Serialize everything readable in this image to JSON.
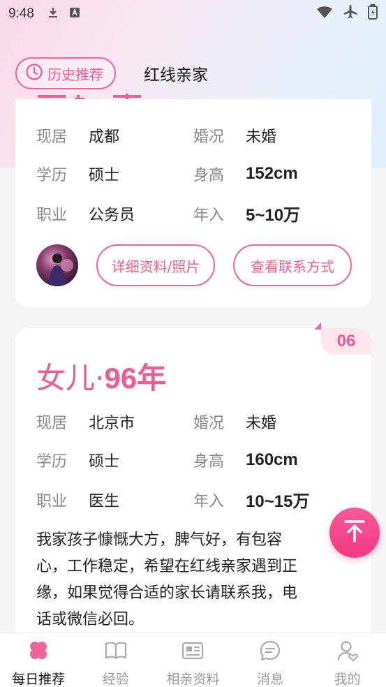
{
  "status_bar": {
    "time": "9:48"
  },
  "top_tabs": {
    "history": "历史推荐",
    "current": "红线亲家"
  },
  "card1": {
    "rows": [
      {
        "k1": "现居",
        "v1": "成都",
        "k2": "婚况",
        "v2": "未婚"
      },
      {
        "k1": "学历",
        "v1": "硕士",
        "k2": "身高",
        "v2": "152cm"
      },
      {
        "k1": "职业",
        "v1": "公务员",
        "k2": "年入",
        "v2": "5~10万"
      }
    ],
    "detail_btn": "详细资料/照片",
    "contact_btn": "查看联系方式"
  },
  "card2": {
    "badge": "06",
    "title_prefix": "女儿·",
    "title_year": "96年",
    "rows": [
      {
        "k1": "现居",
        "v1": "北京市",
        "k2": "婚况",
        "v2": "未婚"
      },
      {
        "k1": "学历",
        "v1": "硕士",
        "k2": "身高",
        "v2": "160cm"
      },
      {
        "k1": "职业",
        "v1": "医生",
        "k2": "年入",
        "v2": "10~15万"
      }
    ],
    "desc_lines": [
      "我家孩子慷慨大方，脾气好，有包容",
      "心，工作稳定，希望在红线亲家遇到正",
      "缘，如果觉得合适的家长请联系我，电",
      "话或微信必回。"
    ]
  },
  "nav": {
    "items": [
      {
        "label": "每日推荐"
      },
      {
        "label": "经验"
      },
      {
        "label": "相亲资料"
      },
      {
        "label": "消息"
      },
      {
        "label": "我的"
      }
    ]
  },
  "colors": {
    "accent": "#ef5a93",
    "fab": "#f2397f"
  }
}
